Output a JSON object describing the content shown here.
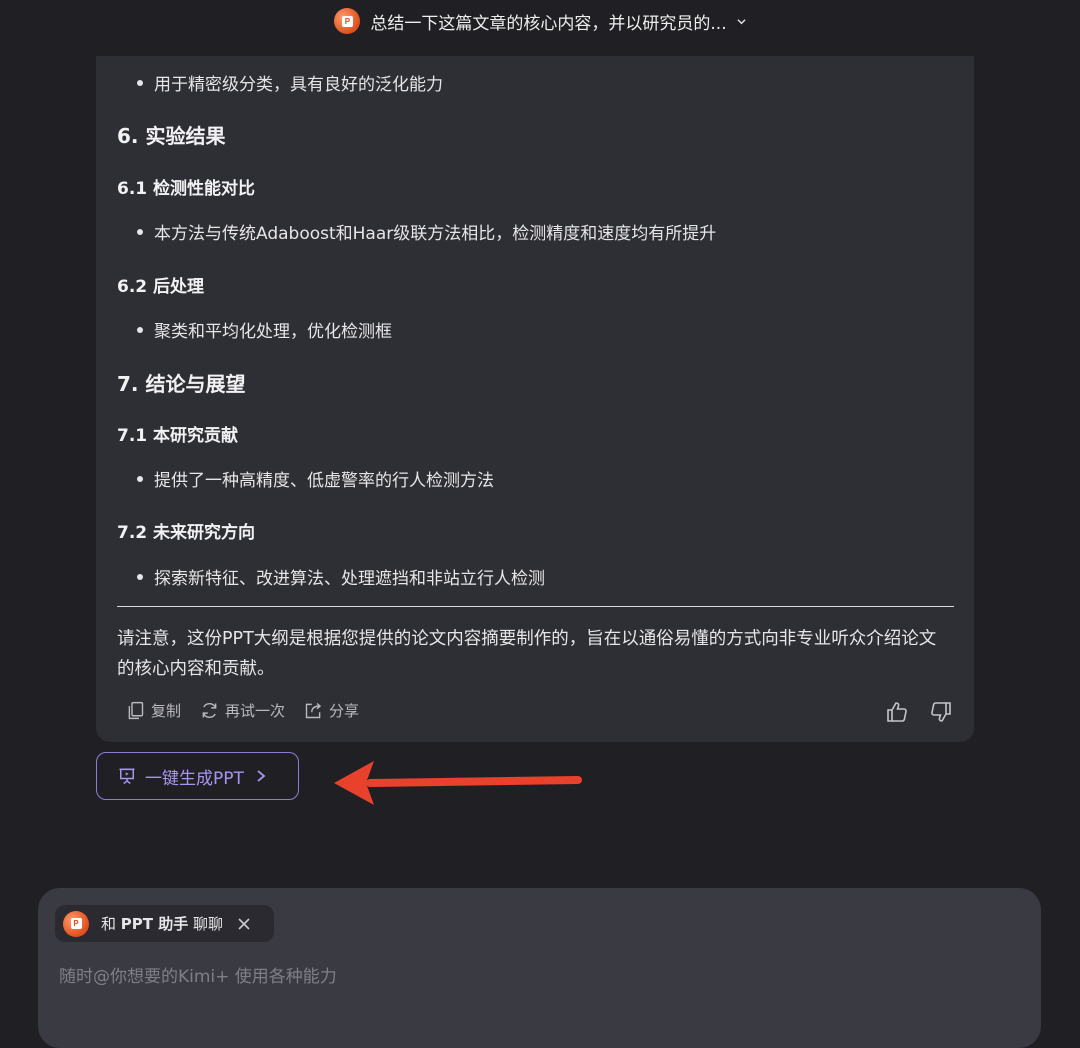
{
  "header": {
    "title": "总结一下这篇文章的核心内容，并以研究员的..."
  },
  "content": {
    "bullet_top": "用于精密级分类，具有良好的泛化能力",
    "h6": "6. 实验结果",
    "h6_1": "6.1 检测性能对比",
    "b6_1": "本方法与传统Adaboost和Haar级联方法相比，检测精度和速度均有所提升",
    "h6_2": "6.2 后处理",
    "b6_2": "聚类和平均化处理，优化检测框",
    "h7": "7. 结论与展望",
    "h7_1": "7.1 本研究贡献",
    "b7_1": "提供了一种高精度、低虚警率的行人检测方法",
    "h7_2": "7.2 未来研究方向",
    "b7_2": "探索新特征、改进算法、处理遮挡和非站立行人检测",
    "note": "请注意，这份PPT大纲是根据您提供的论文内容摘要制作的，旨在以通俗易懂的方式向非专业听众介绍论文的核心内容和贡献。"
  },
  "actions": {
    "copy": "复制",
    "retry": "再试一次",
    "share": "分享"
  },
  "generate_button": {
    "label": "一键生成PPT"
  },
  "composer": {
    "chip_prefix": "和",
    "chip_name": "PPT 助手",
    "chip_suffix": "聊聊",
    "placeholder": "随时@你想要的Kimi+ 使用各种能力"
  },
  "colors": {
    "background": "#202024",
    "card": "#2e2e35",
    "accent": "#a794ee",
    "arrow": "#e8412c"
  }
}
